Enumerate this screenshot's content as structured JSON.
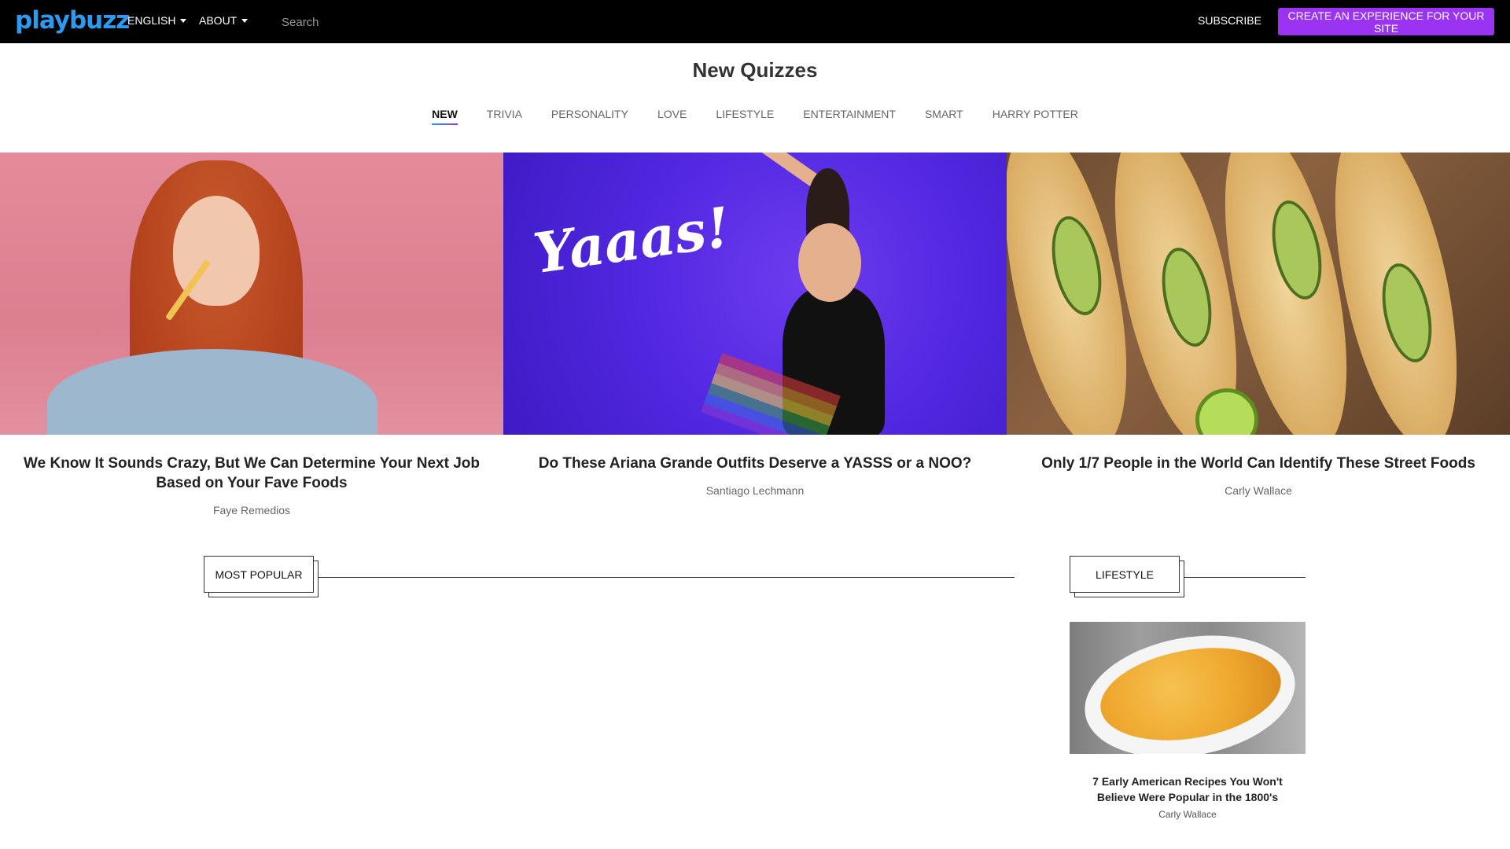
{
  "header": {
    "logo": "playbuzz",
    "nav": [
      {
        "label": "ENGLISH"
      },
      {
        "label": "ABOUT"
      }
    ],
    "search_placeholder": "Search",
    "subscribe_label": "SUBSCRIBE",
    "cta_label": "CREATE AN EXPERIENCE FOR YOUR SITE",
    "accent_color": "#9b34f2",
    "logo_color": "#2b9bf2"
  },
  "page": {
    "title": "New Quizzes",
    "tabs": [
      {
        "label": "NEW",
        "active": true
      },
      {
        "label": "TRIVIA"
      },
      {
        "label": "PERSONALITY"
      },
      {
        "label": "LOVE"
      },
      {
        "label": "LIFESTYLE"
      },
      {
        "label": "ENTERTAINMENT"
      },
      {
        "label": "SMART"
      },
      {
        "label": "HARRY POTTER"
      }
    ]
  },
  "featured": [
    {
      "title": "We Know It Sounds Crazy, But We Can Determine Your Next Job Based on Your Fave Foods",
      "author": "Faye Remedios"
    },
    {
      "title": "Do These Ariana Grande Outfits Deserve a YASSS or a NOO?",
      "author": "Santiago Lechmann",
      "image_text": "Yaaas!"
    },
    {
      "title": "Only 1/7 People in the World Can Identify These Street Foods",
      "author": "Carly Wallace"
    }
  ],
  "sections": {
    "most_popular": {
      "label": "MOST POPULAR"
    },
    "lifestyle": {
      "label": "LIFESTYLE",
      "items": [
        {
          "title": "7 Early American Recipes You Won't Believe Were Popular in the 1800's",
          "author": "Carly Wallace"
        }
      ]
    }
  }
}
